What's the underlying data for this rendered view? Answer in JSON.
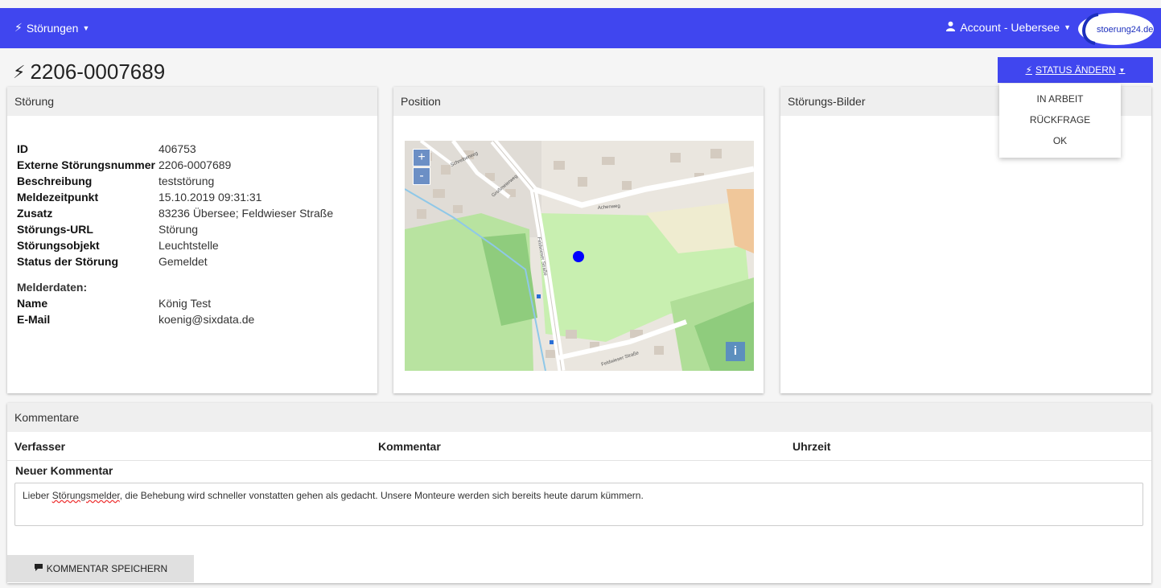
{
  "nav": {
    "menu_label": "Störungen",
    "account_label": "Account - Uebersee",
    "logo_text": "stoerung24.de"
  },
  "page": {
    "title": "2206-0007689",
    "status_button": "STATUS ÄNDERN",
    "status_options": [
      "IN ARBEIT",
      "RÜCKFRAGE",
      "OK"
    ]
  },
  "stoerung": {
    "heading": "Störung",
    "fields": [
      {
        "key": "ID",
        "value": "406753"
      },
      {
        "key": "Externe Störungsnummer",
        "value": "2206-0007689"
      },
      {
        "key": "Beschreibung",
        "value": "teststörung"
      },
      {
        "key": "Meldezeitpunkt",
        "value": "15.10.2019 09:31:31"
      },
      {
        "key": "Zusatz",
        "value": "83236 Übersee; Feldwieser Straße"
      },
      {
        "key": "Störungs-URL",
        "value": "Störung"
      },
      {
        "key": "Störungsobjekt",
        "value": "Leuchtstelle"
      },
      {
        "key": "Status der Störung",
        "value": "Gemeldet"
      }
    ],
    "melder_heading": "Melderdaten:",
    "melder": [
      {
        "key": "Name",
        "value": "König Test"
      },
      {
        "key": "E-Mail",
        "value": "koenig@sixdata.de"
      }
    ]
  },
  "position": {
    "heading": "Position",
    "zoom_in": "+",
    "zoom_out": "-",
    "info": "i",
    "street_labels": [
      "Schreiberweg",
      "Großmeierweg",
      "Achenweg",
      "Feldwieser Straße",
      "Feldwieser Straße"
    ]
  },
  "bilder": {
    "heading": "Störungs-Bilder"
  },
  "kommentare": {
    "heading": "Kommentare",
    "columns": [
      "Verfasser",
      "Kommentar",
      "Uhrzeit"
    ],
    "new_label": "Neuer Kommentar",
    "text_before": "Lieber ",
    "text_misspelled": "Störungsmelder",
    "text_after": ", die Behebung wird schneller vonstatten gehen als gedacht. Unsere Monteure werden sich bereits heute darum kümmern.",
    "save_button": "KOMMENTAR SPEICHERN"
  },
  "colors": {
    "primary": "#4046ef",
    "link": "#f0a030",
    "marker": "#0000ff"
  }
}
